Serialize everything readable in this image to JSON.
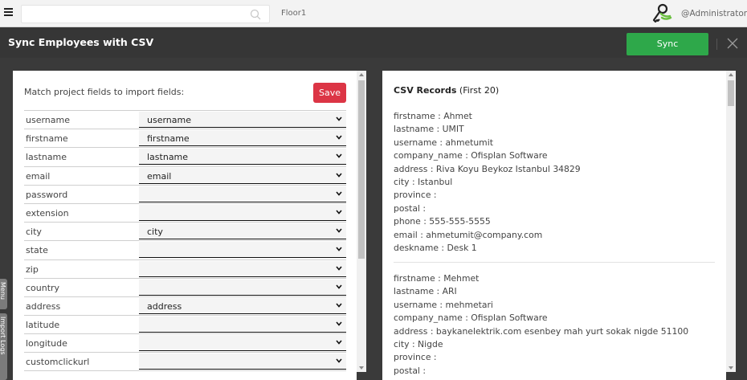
{
  "topbar": {
    "floor": "Floor1",
    "user": "@Administrator"
  },
  "modal": {
    "title": "Sync Employees with CSV",
    "sync_label": "Sync"
  },
  "mapping": {
    "instruction": "Match project fields to import fields:",
    "save_label": "Save",
    "fields": [
      {
        "name": "username",
        "value": "username"
      },
      {
        "name": "firstname",
        "value": "firstname"
      },
      {
        "name": "lastname",
        "value": "lastname"
      },
      {
        "name": "email",
        "value": "email"
      },
      {
        "name": "password",
        "value": ""
      },
      {
        "name": "extension",
        "value": ""
      },
      {
        "name": "city",
        "value": "city"
      },
      {
        "name": "state",
        "value": ""
      },
      {
        "name": "zip",
        "value": ""
      },
      {
        "name": "country",
        "value": ""
      },
      {
        "name": "address",
        "value": "address"
      },
      {
        "name": "latitude",
        "value": ""
      },
      {
        "name": "longitude",
        "value": ""
      },
      {
        "name": "customclickurl",
        "value": ""
      }
    ]
  },
  "csv": {
    "title_bold": "CSV Records",
    "title_rest": " (First 20)",
    "records": [
      [
        "firstname : Ahmet",
        "lastname : UMIT",
        "username : ahmetumit",
        "company_name : Ofisplan Software",
        "address : Riva Koyu Beykoz Istanbul 34829",
        "city : Istanbul",
        "province :",
        "postal :",
        "phone : 555-555-5555",
        "email : ahmetumit@company.com",
        "deskname : Desk 1"
      ],
      [
        "firstname : Mehmet",
        "lastname : ARI",
        "username : mehmetari",
        "company_name : Ofisplan Software",
        "address : baykanelektrik.com esenbey mah yurt sokak nigde 51100",
        "city : Nigde",
        "province :",
        "postal :"
      ]
    ]
  },
  "side_tabs": {
    "menu": "Menu",
    "import_logs": "Import Logs"
  }
}
